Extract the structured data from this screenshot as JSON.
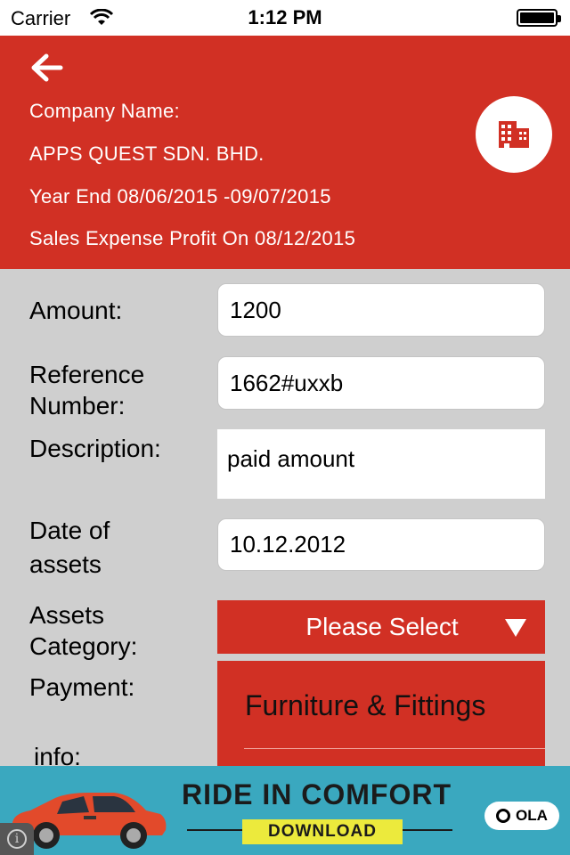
{
  "status_bar": {
    "carrier": "Carrier",
    "time": "1:12 PM"
  },
  "header": {
    "company_label": "Company Name:",
    "company_name": "APPS QUEST SDN. BHD.",
    "year_end": "Year End 08/06/2015 -09/07/2015",
    "sales_expense": "Sales Expense Profit On 08/12/2015",
    "background_color": "#d13024",
    "back_icon": "arrow-left-icon",
    "company_icon": "building-icon"
  },
  "form": {
    "amount": {
      "label": "Amount:",
      "value": "1200"
    },
    "reference": {
      "label_line1": "Reference",
      "label_line2": "Number:",
      "value": "1662#uxxb"
    },
    "description": {
      "label": "Description:",
      "value": "paid amount"
    },
    "date": {
      "label_line1": "Date of",
      "label_line2": "assets",
      "value": "10.12.2012"
    },
    "category": {
      "label_line1": "Assets",
      "label_line2": "Category:",
      "selected": "Please Select"
    },
    "payment": {
      "label_line1": "Payment:",
      "label_line2": "info:"
    }
  },
  "dropdown": {
    "options": [
      "Furniture & Fittings"
    ]
  },
  "ad": {
    "headline": "RIDE IN COMFORT",
    "cta": "DOWNLOAD",
    "brand": "OLA",
    "background_color": "#3aa8bf"
  }
}
